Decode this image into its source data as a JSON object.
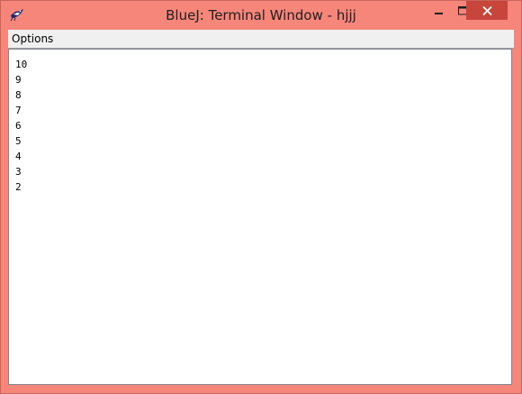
{
  "window": {
    "title": "BlueJ: Terminal Window - hjjj",
    "frame_color": "#f6857a",
    "close_button_color": "#c7453a"
  },
  "menubar": {
    "options_label": "Options"
  },
  "terminal": {
    "lines": [
      "10",
      "9",
      "8",
      "7",
      "6",
      "5",
      "4",
      "3",
      "2"
    ]
  },
  "icons": {
    "app": "bluej-bird-icon",
    "minimize": "minimize-icon",
    "maximize": "maximize-icon",
    "close": "close-icon"
  }
}
